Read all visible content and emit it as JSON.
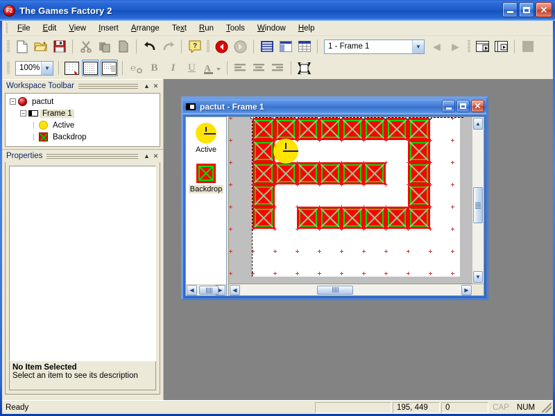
{
  "window": {
    "title": "The Games Factory 2",
    "app_icon": "F2",
    "minimize_label": "Minimize",
    "maximize_label": "Maximize",
    "close_label": "Close"
  },
  "menubar": {
    "items": [
      {
        "label": "File",
        "accel": "F"
      },
      {
        "label": "Edit",
        "accel": "E"
      },
      {
        "label": "View",
        "accel": "V"
      },
      {
        "label": "Insert",
        "accel": "I"
      },
      {
        "label": "Arrange",
        "accel": "A"
      },
      {
        "label": "Text",
        "accel": "x"
      },
      {
        "label": "Run",
        "accel": "R"
      },
      {
        "label": "Tools",
        "accel": "T"
      },
      {
        "label": "Window",
        "accel": "W"
      },
      {
        "label": "Help",
        "accel": "H"
      }
    ]
  },
  "toolbar1": {
    "buttons": [
      {
        "name": "new-file-icon",
        "tip": "New"
      },
      {
        "name": "open-folder-icon",
        "tip": "Open"
      },
      {
        "name": "save-disk-icon",
        "tip": "Save"
      },
      {
        "name": "cut-scissors-icon",
        "tip": "Cut"
      },
      {
        "name": "copy-icon",
        "tip": "Copy"
      },
      {
        "name": "paste-icon",
        "tip": "Paste"
      },
      {
        "name": "undo-icon",
        "tip": "Undo"
      },
      {
        "name": "redo-icon",
        "tip": "Redo"
      },
      {
        "name": "help-icon",
        "tip": "Help"
      },
      {
        "name": "back-arrow-icon",
        "tip": "Back"
      },
      {
        "name": "forward-arrow-icon",
        "tip": "Forward"
      },
      {
        "name": "storyboard-icon",
        "tip": "Storyboard Editor"
      },
      {
        "name": "frame-editor-icon",
        "tip": "Frame Editor"
      },
      {
        "name": "event-editor-icon",
        "tip": "Event Editor"
      }
    ],
    "frame_combo": {
      "value": "1 - Frame 1",
      "options": [
        "1 - Frame 1"
      ]
    },
    "nav_prev": "Previous Frame",
    "nav_next": "Next Frame",
    "run_buttons": [
      {
        "name": "run-application-icon",
        "tip": "Run Application"
      },
      {
        "name": "run-frame-icon",
        "tip": "Run Frame"
      },
      {
        "name": "stop-icon",
        "tip": "Stop"
      }
    ]
  },
  "toolbar2": {
    "zoom": {
      "value": "100%",
      "options": [
        "100%"
      ]
    },
    "buttons": [
      {
        "name": "grid-setup-icon",
        "tip": "Grid Setup"
      },
      {
        "name": "show-grid-icon",
        "tip": "Show Grid",
        "checked": true
      },
      {
        "name": "snap-to-grid-icon",
        "tip": "Snap To Grid",
        "checked": true
      },
      {
        "name": "font-select-icon",
        "tip": "Font"
      },
      {
        "name": "bold-icon",
        "tip": "Bold",
        "label": "B"
      },
      {
        "name": "italic-icon",
        "tip": "Italic",
        "label": "I"
      },
      {
        "name": "underline-icon",
        "tip": "Underline",
        "label": "U"
      },
      {
        "name": "font-color-icon",
        "tip": "Font Color",
        "label": "A"
      },
      {
        "name": "align-left-icon",
        "tip": "Align Left"
      },
      {
        "name": "align-center-icon",
        "tip": "Align Center"
      },
      {
        "name": "align-right-icon",
        "tip": "Align Right"
      },
      {
        "name": "fit-size-icon",
        "tip": "Fit Size"
      }
    ]
  },
  "workspace_panel": {
    "title": "Workspace Toolbar",
    "collapse_label": "▲",
    "close_label": "✕",
    "tree": [
      {
        "label": "pactut",
        "icon": "application-icon",
        "level": 0,
        "expander": "−",
        "selected": false
      },
      {
        "label": "Frame 1",
        "icon": "frame-icon",
        "level": 1,
        "expander": "−",
        "selected": true
      },
      {
        "label": "Active",
        "icon": "active-object-icon",
        "level": 2,
        "expander": "",
        "selected": false
      },
      {
        "label": "Backdrop",
        "icon": "backdrop-object-icon",
        "level": 2,
        "expander": "",
        "selected": false
      }
    ]
  },
  "properties_panel": {
    "title": "Properties",
    "collapse_label": "▲",
    "close_label": "✕",
    "empty_title": "No Item Selected",
    "empty_desc": "Select an item to see its description"
  },
  "child_window": {
    "title": "pactut - Frame 1",
    "minimize_label": "Minimize",
    "maximize_label": "Maximize",
    "close_label": "Close",
    "objects": [
      {
        "label": "Active",
        "icon": "active-object-icon",
        "selected": false
      },
      {
        "label": "Backdrop",
        "icon": "backdrop-object-icon",
        "selected": true
      }
    ],
    "scroll": {
      "v_up": "▲",
      "v_down": "▼",
      "h_left": "◀",
      "h_right": "▶"
    }
  },
  "canvas": {
    "grid_cell": 32,
    "backdrop_cells": [
      {
        "col": 0,
        "row": 0
      },
      {
        "col": 1,
        "row": 0
      },
      {
        "col": 2,
        "row": 0
      },
      {
        "col": 3,
        "row": 0
      },
      {
        "col": 4,
        "row": 0
      },
      {
        "col": 5,
        "row": 0
      },
      {
        "col": 6,
        "row": 0
      },
      {
        "col": 7,
        "row": 0
      },
      {
        "col": 0,
        "row": 1
      },
      {
        "col": 7,
        "row": 1
      },
      {
        "col": 0,
        "row": 2
      },
      {
        "col": 1,
        "row": 2
      },
      {
        "col": 2,
        "row": 2
      },
      {
        "col": 3,
        "row": 2
      },
      {
        "col": 4,
        "row": 2
      },
      {
        "col": 5,
        "row": 2
      },
      {
        "col": 7,
        "row": 2
      },
      {
        "col": 0,
        "row": 3
      },
      {
        "col": 7,
        "row": 3
      },
      {
        "col": 0,
        "row": 4
      },
      {
        "col": 2,
        "row": 4
      },
      {
        "col": 3,
        "row": 4
      },
      {
        "col": 4,
        "row": 4
      },
      {
        "col": 5,
        "row": 4
      },
      {
        "col": 6,
        "row": 4
      },
      {
        "col": 7,
        "row": 4
      }
    ],
    "active_object": {
      "col": 1,
      "row": 1,
      "name": "pacman-sprite"
    }
  },
  "statusbar": {
    "message": "Ready",
    "coordinates": "195, 449",
    "object_count": "0",
    "caps_indicator": "CAP",
    "num_indicator": "NUM"
  },
  "colors": {
    "titlebar_blue": "#1c5bc8",
    "panel_bg": "#ece9d8",
    "backdrop_red": "#ff0000",
    "backdrop_green": "#00dd00",
    "active_yellow": "#ffe400",
    "mdi_gray": "#838383"
  }
}
